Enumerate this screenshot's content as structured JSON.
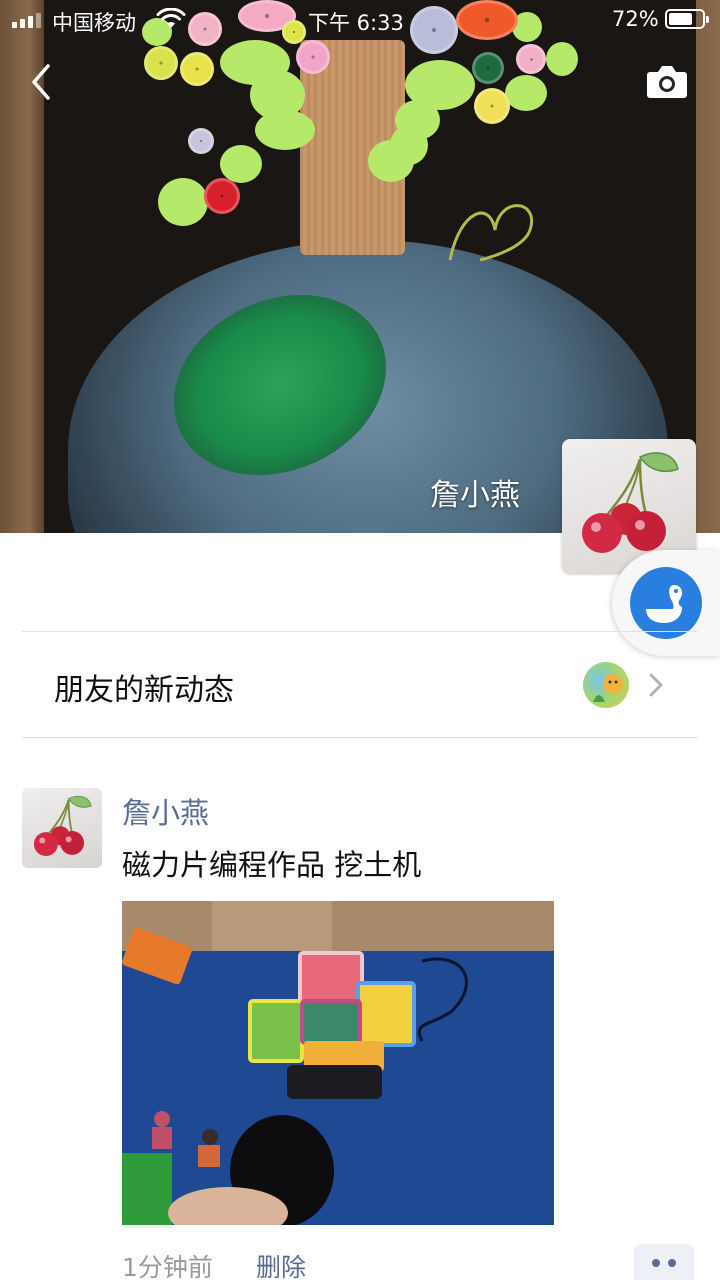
{
  "status_bar": {
    "carrier": "中国移动",
    "time": "下午 6:33",
    "battery_percent_label": "72%",
    "battery_level": 0.72
  },
  "header": {
    "back_icon": "chevron-left-icon",
    "camera_icon": "camera-icon"
  },
  "profile": {
    "name": "詹小燕",
    "avatar_icon": "cherry-avatar"
  },
  "floating_button": {
    "icon": "bird-logo-icon",
    "color": "#2a7ee0"
  },
  "friends_updates": {
    "label": "朋友的新动态",
    "chevron_icon": "chevron-right-icon"
  },
  "post": {
    "author": "詹小燕",
    "text": "磁力片编程作品 挖土机",
    "time": "1分钟前",
    "delete_label": "删除",
    "more_icon": "more-dots-icon"
  },
  "colors": {
    "link_blue": "#5b6b94",
    "muted_gray": "#9a9a9a",
    "accent_blue": "#2a7ee0"
  }
}
